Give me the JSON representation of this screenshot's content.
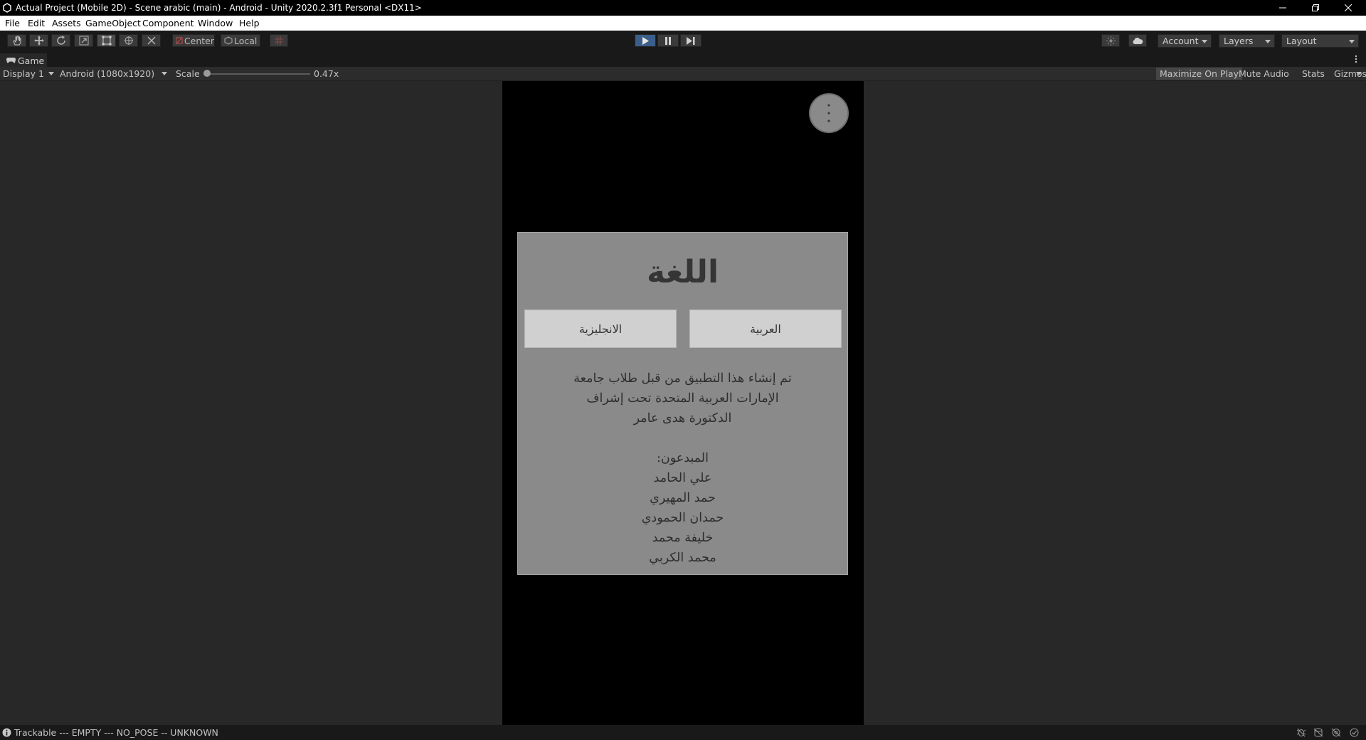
{
  "window": {
    "title": "Actual Project (Mobile 2D) - Scene arabic (main) - Android - Unity 2020.2.3f1 Personal <DX11>",
    "controls": [
      "minimize-icon",
      "restore-icon",
      "close-icon"
    ]
  },
  "menu": [
    "File",
    "Edit",
    "Assets",
    "GameObject",
    "Component",
    "Window",
    "Help"
  ],
  "toolbar": {
    "tools": [
      "hand-icon",
      "move-icon",
      "rotate-icon",
      "scale-icon",
      "rect-tool-icon",
      "transform-icon",
      "custom-tool-icon"
    ],
    "pivot_label": "Center",
    "space_label": "Local",
    "account_label": "Account",
    "layers_label": "Layers",
    "layout_label": "Layout"
  },
  "game_tab": {
    "label": "Game",
    "display": "Display 1",
    "resolution": "Android (1080x1920)",
    "scale_label": "Scale",
    "scale_value": "0.47x",
    "maximize_on_play": "Maximize On Play",
    "mute_audio": "Mute Audio",
    "stats": "Stats",
    "gizmos": "Gizmos"
  },
  "scene": {
    "panel_title": "اللغة",
    "btn_english": "الانجليزية",
    "btn_arabic": "العربية",
    "credits_intro": [
      "تم إنشاء هذا التطبيق من قبل طلاب جامعة",
      "الإمارات العربية المتحدة تحت إشراف",
      "الدكتورة هدى عامر"
    ],
    "creators_heading": "المبدعون:",
    "creators": [
      "علي الحامد",
      "حمد المهيري",
      "حمدان الحمودي",
      "خليفة محمد",
      "محمد الكربي"
    ]
  },
  "status": {
    "text": "Trackable --- EMPTY --- NO_POSE -- UNKNOWN"
  }
}
